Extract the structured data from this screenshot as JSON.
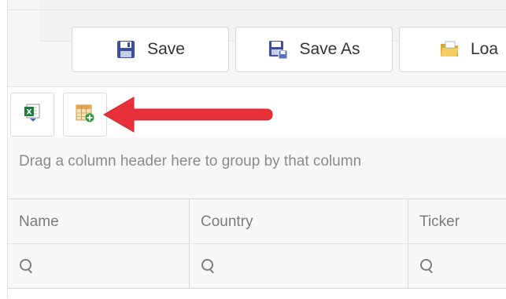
{
  "toolbar": {
    "save_label": "Save",
    "save_as_label": "Save As",
    "load_label": "Loa"
  },
  "grid_toolbar": {
    "export_icon": "excel-export-icon",
    "column_chooser_icon": "column-chooser-icon"
  },
  "group_panel": {
    "text": "Drag a column header here to group by that column"
  },
  "columns": [
    {
      "label": "Name"
    },
    {
      "label": "Country"
    },
    {
      "label": "Ticker"
    }
  ],
  "filter_icon": "search-icon",
  "annotation": {
    "arrow_color": "#e8303a",
    "points_to": "column-chooser-button"
  },
  "colors": {
    "accent_red": "#e8303a",
    "border": "#dadada",
    "panel_bg": "#f8f8f8"
  }
}
